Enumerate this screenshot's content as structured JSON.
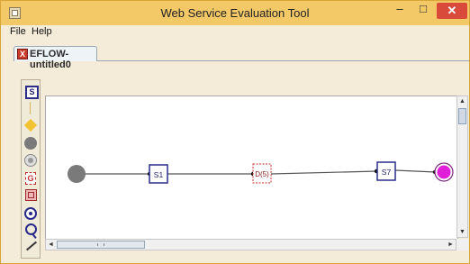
{
  "window": {
    "title": "Web Service Evaluation Tool",
    "minimize_glyph": "–",
    "maximize_glyph": "□",
    "close_glyph": "✕"
  },
  "menu": {
    "items": [
      "File",
      "Help"
    ]
  },
  "tabs": [
    {
      "label": "EFLOW-untitled0",
      "close_glyph": "X",
      "active": true
    }
  ],
  "palette": {
    "tools": [
      {
        "name": "service-tool",
        "glyph": "S"
      },
      {
        "name": "line-tool"
      },
      {
        "name": "decision-tool"
      },
      {
        "name": "start-tool"
      },
      {
        "name": "join-tool"
      },
      {
        "name": "gate-tool",
        "glyph": "G"
      },
      {
        "name": "subflow-tool"
      },
      {
        "name": "end-tool"
      },
      {
        "name": "zoom-tool"
      },
      {
        "name": "connector-tool"
      }
    ]
  },
  "diagram": {
    "nodes": [
      {
        "id": "start",
        "type": "start",
        "label": ""
      },
      {
        "id": "S1",
        "type": "service",
        "label": "S1"
      },
      {
        "id": "D5",
        "type": "gate",
        "label": "D(5)"
      },
      {
        "id": "S7",
        "type": "service",
        "label": "S7"
      },
      {
        "id": "end",
        "type": "end",
        "label": ""
      }
    ],
    "colors": {
      "start": "#7a7a7a",
      "service_border": "#2c2c8a",
      "gate_border": "#c03030",
      "end": "#e020d8",
      "edge": "#555555"
    }
  },
  "scroll": {
    "up": "▲",
    "down": "▼",
    "left": "◄",
    "right": "►"
  }
}
